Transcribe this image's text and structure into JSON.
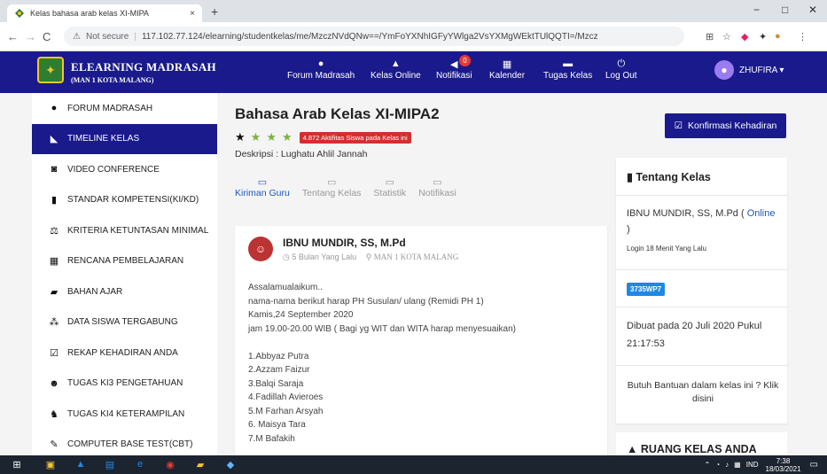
{
  "browser": {
    "tab_title": "Kelas bahasa arab kelas XI-MIPA",
    "tab_close": "×",
    "new_tab": "+",
    "nav": {
      "back": "←",
      "forward": "→",
      "reload": "C"
    },
    "url_security": "Not secure",
    "url": "117.102.77.124/elearning/studentkelas/me/MzczNVdQNw==/YmFoYXNhIGFyYWlga2VsYXMgWEktTUlQQTI=/Mzcz",
    "window_controls": {
      "minimize": "−",
      "maximize": "□",
      "close": "✕"
    }
  },
  "appnav": {
    "brand_title": "ELEARNING MADRASAH",
    "brand_subtitle": "(MAN 1 KOTA MALANG)",
    "items": [
      {
        "label": "Forum Madrasah",
        "icon": "comments-icon"
      },
      {
        "label": "Kelas Online",
        "icon": "graduation-cap-icon"
      },
      {
        "label": "Notifikasi",
        "icon": "bullhorn-icon",
        "badge": "0"
      },
      {
        "label": "Kalender",
        "icon": "calendar-icon"
      },
      {
        "label": "Tugas Kelas",
        "icon": "folder-icon"
      },
      {
        "label": "Log Out",
        "icon": "power-icon"
      }
    ],
    "user": "ZHUFIRA"
  },
  "sidebar": {
    "items": [
      {
        "label": "FORUM MADRASAH",
        "icon": "comments-icon"
      },
      {
        "label": "TIMELINE KELAS",
        "icon": "rss-icon",
        "active": true
      },
      {
        "label": "VIDEO CONFERENCE",
        "icon": "camera-icon"
      },
      {
        "label": "STANDAR KOMPETENSI(KI/KD)",
        "icon": "book-icon"
      },
      {
        "label": "KRITERIA KETUNTASAN MINIMAL",
        "icon": "balance-scale-icon"
      },
      {
        "label": "RENCANA PEMBELAJARAN",
        "icon": "calendar-icon"
      },
      {
        "label": "BAHAN AJAR",
        "icon": "folder-open-icon"
      },
      {
        "label": "DATA SISWA TERGABUNG",
        "icon": "users-icon"
      },
      {
        "label": "REKAP KEHADIRAN ANDA",
        "icon": "check-square-icon"
      },
      {
        "label": "TUGAS KI3 PENGETAHUAN",
        "icon": "people-icon"
      },
      {
        "label": "TUGAS KI4 KETERAMPILAN",
        "icon": "chess-knight-icon"
      },
      {
        "label": "COMPUTER BASE TEST(CBT)",
        "icon": "edit-icon"
      }
    ]
  },
  "main": {
    "title": "Bahasa Arab Kelas XI-MIPA2",
    "star_colors": [
      "#111111",
      "#7cb342",
      "#7cb342",
      "#7cb342"
    ],
    "activity_badge": "4.872 Aktifitas Siswa pada Kelas ini",
    "description": "Deskripsi : Lughatu Ahlil Jannah",
    "tabs": [
      {
        "label": "Kiriman Guru",
        "active": true
      },
      {
        "label": "Tentang Kelas",
        "active": false
      },
      {
        "label": "Statistik",
        "active": false
      },
      {
        "label": "Notifikasi",
        "active": false
      }
    ],
    "post": {
      "author": "IBNU MUNDIR, SS, M.Pd",
      "time": "5 Bulan Yang Lalu",
      "institution": "MAN 1 KOTA MALANG",
      "lines": [
        "Assalamualaikum..",
        "nama-nama berikut harap PH Susulan/ ulang (Remidi PH 1)",
        "Kamis,24 September 2020",
        "jam 19.00-20.00 WIB ( Bagi yg WIT dan WITA harap menyesuaikan)",
        "",
        "1.Abbyaz Putra",
        "2.Azzam Faizur",
        "3.Balqi Saraja",
        "4.Fadillah Avieroes",
        "5.M Farhan Arsyah",
        "6. Maisya Tara",
        "7.M Bafakih"
      ]
    }
  },
  "right": {
    "confirm_button": "Konfirmasi Kehadiran",
    "about": {
      "title": "Tentang Kelas",
      "teacher": "IBNU MUNDIR, SS, M.Pd (",
      "online": "Online",
      "teacher_close": ")",
      "login": "Login 18 Menit Yang Lalu",
      "code": "3735WP7",
      "created": "Dibuat pada 20 Juli 2020 Pukul 21:17:53",
      "help": "Butuh Bantuan dalam kelas ini ? Klik disini"
    },
    "room_title": "RUANG KELAS ANDA"
  },
  "taskbar": {
    "time": "7:38",
    "date": "18/03/2021",
    "lang": "IND"
  },
  "colors": {
    "nav_bg": "#1a1a8c",
    "activity_badge": "#d32f2f",
    "link": "#1e57c4",
    "code_badge": "#1e88e5"
  }
}
